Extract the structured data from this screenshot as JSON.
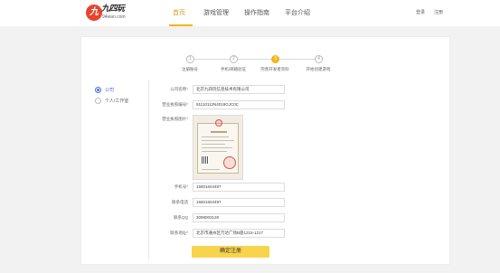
{
  "header": {
    "logo": {
      "mark": "九",
      "name": "九四玩",
      "domain": "94wan.com"
    },
    "nav": [
      {
        "label": "首页",
        "active": true
      },
      {
        "label": "游戏管理",
        "active": false
      },
      {
        "label": "操作指南",
        "active": false
      },
      {
        "label": "平台介绍",
        "active": false
      }
    ],
    "login_label": "登录",
    "register_label": "注册"
  },
  "steps": [
    {
      "num": "1",
      "label": "注册账号",
      "active": false
    },
    {
      "num": "2",
      "label": "手机/邮箱验证",
      "active": false
    },
    {
      "num": "3",
      "label": "完善开发者资料",
      "active": true
    },
    {
      "num": "4",
      "label": "开始创建游戏",
      "active": false
    }
  ],
  "account_type": {
    "options": [
      {
        "label": "公司",
        "checked": true
      },
      {
        "label": "个人/工作室",
        "checked": false
      }
    ]
  },
  "form": {
    "company_name": {
      "label": "公司名称*",
      "value": "北京九四玩信息技术有限公司"
    },
    "license_no": {
      "label": "营业执照编号*",
      "value": "91110112N4019GJC0C"
    },
    "license_photo": {
      "label": "营业执照图片*"
    },
    "phone": {
      "label": "手机号*",
      "value": "15801604497"
    },
    "contact_phone": {
      "label": "联系电话",
      "value": "15801604497"
    },
    "qq": {
      "label": "联系QQ",
      "value": "3098003128"
    },
    "address": {
      "label": "联系地址*",
      "value": "北京市通州区万达广场B座1215-1217"
    }
  },
  "submit_label": "确定注册",
  "colors": {
    "accent": "#f2b614",
    "button": "#f7d44c",
    "radio": "#4a6fd1",
    "logo": "#e8442e"
  }
}
